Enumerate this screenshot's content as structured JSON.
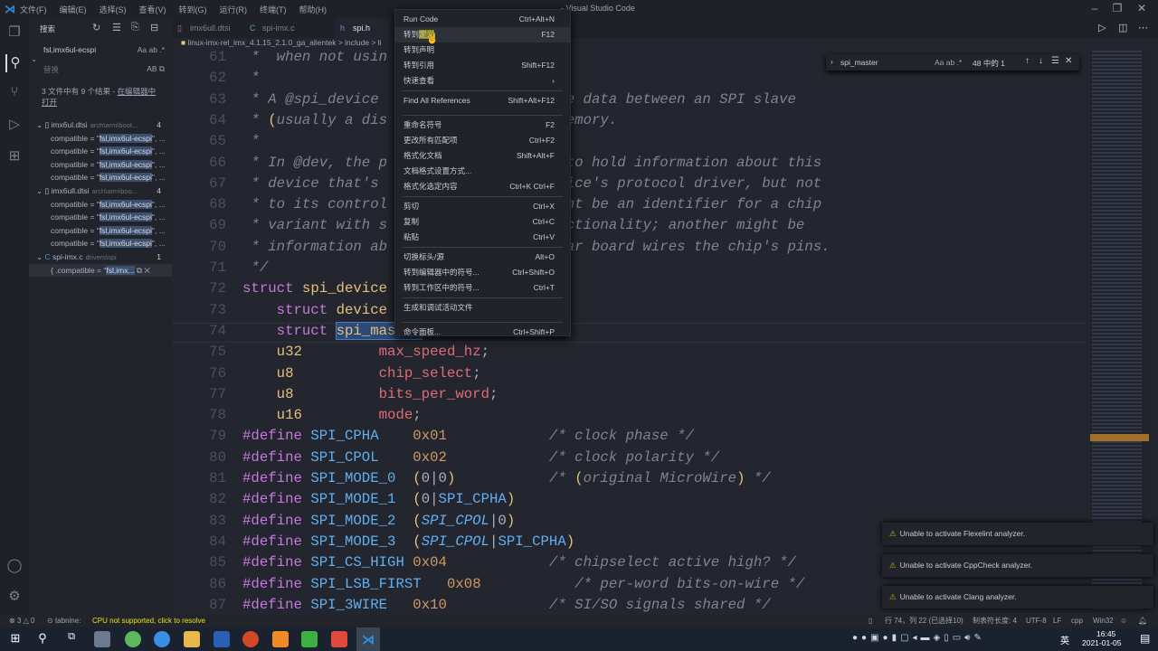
{
  "window": {
    "title": "- Visual Studio Code",
    "menus": [
      "文件(F)",
      "编辑(E)",
      "选择(S)",
      "查看(V)",
      "转到(G)",
      "运行(R)",
      "终端(T)",
      "帮助(H)"
    ]
  },
  "sidebar": {
    "title": "搜索",
    "search_value": "fsl,imx6ul-ecspi",
    "replace_placeholder": "替换",
    "summary": "3 文件中有 9 个结果 - ",
    "open_in_editor": "在编辑器中打开",
    "files": [
      {
        "name": "imx6ul.dtsi",
        "path": "arch\\arm\\boot...",
        "count": "4",
        "matches": [
          "compatible = \"|fsl,imx6ul-ecspi|\", ...",
          "compatible = \"|fsl,imx6ul-ecspi|\", ...",
          "compatible = \"|fsl,imx6ul-ecspi|\", ...",
          "compatible = \"|fsl,imx6ul-ecspi|\", ..."
        ]
      },
      {
        "name": "imx6ull.dtsi",
        "path": "arch\\arm\\boo...",
        "count": "4",
        "matches": [
          "compatible = \"|fsl,imx6ul-ecspi|\", ...",
          "compatible = \"|fsl,imx6ul-ecspi|\", ...",
          "compatible = \"|fsl,imx6ul-ecspi|\", ...",
          "compatible = \"|fsl,imx6ul-ecspi|\", ..."
        ]
      },
      {
        "name": "spi-imx.c",
        "path": "drivers\\spi",
        "count": "1",
        "matches": [
          "{ .compatible = \"|fsl,imx...|"
        ]
      }
    ]
  },
  "tabs": [
    {
      "label": "imx6ull.dtsi",
      "icon": "file-icon"
    },
    {
      "label": "spi-imx.c",
      "icon": "c-file-icon"
    },
    {
      "label": "spi.h",
      "icon": "h-file-icon",
      "active": true
    }
  ],
  "breadcrumb": "linux-imx-rel_imx_4.1.15_2.1.0_ga_alientek > include > li",
  "find": {
    "value": "spi_master",
    "result": "48 中的 1"
  },
  "code": [
    {
      "n": "61",
      "t": [
        [
          "c",
          " *  when not usin"
        ]
      ]
    },
    {
      "n": "62",
      "t": [
        [
          "c",
          " *"
        ]
      ]
    },
    {
      "n": "63",
      "t": [
        [
          "c",
          " * A @spi_device                      e data between an SPI slave"
        ]
      ]
    },
    {
      "n": "64",
      "t": [
        [
          "c",
          " * "
        ],
        [
          "p",
          "("
        ],
        [
          "c",
          "usually a dis                     emory."
        ]
      ]
    },
    {
      "n": "65",
      "t": [
        [
          "c",
          " *"
        ]
      ]
    },
    {
      "n": "66",
      "t": [
        [
          "c",
          " * In @dev, the p                     to hold information about this"
        ]
      ]
    },
    {
      "n": "67",
      "t": [
        [
          "c",
          " * device that's                      ice's protocol driver, but not"
        ]
      ]
    },
    {
      "n": "68",
      "t": [
        [
          "c",
          " * to its control                     ht be an identifier for a chip"
        ]
      ]
    },
    {
      "n": "69",
      "t": [
        [
          "c",
          " * variant with s                     ctionality; another might be"
        ]
      ]
    },
    {
      "n": "70",
      "t": [
        [
          "c",
          " * information ab                     ar board wires the chip's pins."
        ]
      ]
    },
    {
      "n": "71",
      "t": [
        [
          "c",
          " */"
        ]
      ]
    },
    {
      "n": "72",
      "t": [
        [
          "k",
          "struct "
        ],
        [
          "t",
          "spi_device"
        ]
      ]
    },
    {
      "n": "73",
      "t": [
        [
          "x",
          "    "
        ],
        [
          "k",
          "struct "
        ],
        [
          "t",
          "device"
        ]
      ]
    },
    {
      "n": "74",
      "t": [
        [
          "x",
          "    "
        ],
        [
          "k",
          "struct "
        ],
        [
          "ts",
          "spi_master"
        ],
        [
          "x",
          "    "
        ],
        [
          "f",
          "*master"
        ],
        [
          "x",
          ";"
        ]
      ]
    },
    {
      "n": "75",
      "t": [
        [
          "x",
          "    "
        ],
        [
          "t",
          "u32"
        ],
        [
          "x",
          "         "
        ],
        [
          "f",
          "max_speed_hz"
        ],
        [
          "x",
          ";"
        ]
      ]
    },
    {
      "n": "76",
      "t": [
        [
          "x",
          "    "
        ],
        [
          "t",
          "u8"
        ],
        [
          "x",
          "          "
        ],
        [
          "f",
          "chip_select"
        ],
        [
          "x",
          ";"
        ]
      ]
    },
    {
      "n": "77",
      "t": [
        [
          "x",
          "    "
        ],
        [
          "t",
          "u8"
        ],
        [
          "x",
          "          "
        ],
        [
          "f",
          "bits_per_word"
        ],
        [
          "x",
          ";"
        ]
      ]
    },
    {
      "n": "78",
      "t": [
        [
          "x",
          "    "
        ],
        [
          "t",
          "u16"
        ],
        [
          "x",
          "         "
        ],
        [
          "f",
          "mode"
        ],
        [
          "x",
          ";"
        ]
      ]
    },
    {
      "n": "79",
      "t": [
        [
          "k",
          "#define "
        ],
        [
          "m",
          "SPI_CPHA"
        ],
        [
          "x",
          "    "
        ],
        [
          "n",
          "0x01"
        ],
        [
          "x",
          "            "
        ],
        [
          "c",
          "/* clock phase */"
        ]
      ]
    },
    {
      "n": "80",
      "t": [
        [
          "k",
          "#define "
        ],
        [
          "m",
          "SPI_CPOL"
        ],
        [
          "x",
          "    "
        ],
        [
          "n",
          "0x02"
        ],
        [
          "x",
          "            "
        ],
        [
          "c",
          "/* clock polarity */"
        ]
      ]
    },
    {
      "n": "81",
      "t": [
        [
          "k",
          "#define "
        ],
        [
          "m",
          "SPI_MODE_0"
        ],
        [
          "x",
          "  "
        ],
        [
          "p",
          "("
        ],
        [
          "x",
          "0|0"
        ],
        [
          "p",
          ")"
        ],
        [
          "x",
          "           "
        ],
        [
          "c",
          "/* "
        ],
        [
          "p",
          "("
        ],
        [
          "c",
          "original MicroWire"
        ],
        [
          "p",
          ")"
        ],
        [
          "c",
          " */"
        ]
      ]
    },
    {
      "n": "82",
      "t": [
        [
          "k",
          "#define "
        ],
        [
          "m",
          "SPI_MODE_1"
        ],
        [
          "x",
          "  "
        ],
        [
          "p",
          "("
        ],
        [
          "x",
          "0|"
        ],
        [
          "m",
          "SPI_CPHA"
        ],
        [
          "p",
          ")"
        ]
      ]
    },
    {
      "n": "83",
      "t": [
        [
          "k",
          "#define "
        ],
        [
          "m",
          "SPI_MODE_2"
        ],
        [
          "x",
          "  "
        ],
        [
          "p",
          "("
        ],
        [
          "mi",
          "SPI_CPOL"
        ],
        [
          "x",
          "|0"
        ],
        [
          "p",
          ")"
        ]
      ]
    },
    {
      "n": "84",
      "t": [
        [
          "k",
          "#define "
        ],
        [
          "m",
          "SPI_MODE_3"
        ],
        [
          "x",
          "  "
        ],
        [
          "p",
          "("
        ],
        [
          "mi",
          "SPI_CPOL"
        ],
        [
          "x",
          "|"
        ],
        [
          "m",
          "SPI_CPHA"
        ],
        [
          "p",
          ")"
        ]
      ]
    },
    {
      "n": "85",
      "t": [
        [
          "k",
          "#define "
        ],
        [
          "m",
          "SPI_CS_HIGH"
        ],
        [
          "x",
          " "
        ],
        [
          "n",
          "0x04"
        ],
        [
          "x",
          "            "
        ],
        [
          "c",
          "/* chipselect active high? */"
        ]
      ]
    },
    {
      "n": "86",
      "t": [
        [
          "k",
          "#define "
        ],
        [
          "m",
          "SPI_LSB_FIRST"
        ],
        [
          "x",
          "   "
        ],
        [
          "n",
          "0x08"
        ],
        [
          "x",
          "           "
        ],
        [
          "c",
          "/* per-word bits-on-wire */"
        ]
      ]
    },
    {
      "n": "87",
      "t": [
        [
          "k",
          "#define "
        ],
        [
          "m",
          "SPI_3WIRE"
        ],
        [
          "x",
          "   "
        ],
        [
          "n",
          "0x10"
        ],
        [
          "x",
          "            "
        ],
        [
          "c",
          "/* SI/SO signals shared */"
        ]
      ]
    }
  ],
  "context_menu": [
    [
      {
        "label": "Run Code",
        "shortcut": "Ctrl+Alt+N"
      },
      {
        "label": "转到定义",
        "shortcut": "F12",
        "hover": true
      },
      {
        "label": "转到声明",
        "shortcut": ""
      },
      {
        "label": "转到引用",
        "shortcut": "Shift+F12"
      },
      {
        "label": "快速查看",
        "shortcut": "›"
      }
    ],
    [
      {
        "label": "Find All References",
        "shortcut": "Shift+Alt+F12"
      }
    ],
    [
      {
        "label": "重命名符号",
        "shortcut": "F2"
      },
      {
        "label": "更改所有匹配项",
        "shortcut": "Ctrl+F2"
      },
      {
        "label": "格式化文档",
        "shortcut": "Shift+Alt+F"
      },
      {
        "label": "文档格式设置方式...",
        "shortcut": ""
      },
      {
        "label": "格式化选定内容",
        "shortcut": "Ctrl+K Ctrl+F"
      }
    ],
    [
      {
        "label": "剪切",
        "shortcut": "Ctrl+X"
      },
      {
        "label": "复制",
        "shortcut": "Ctrl+C"
      },
      {
        "label": "粘贴",
        "shortcut": "Ctrl+V"
      }
    ],
    [
      {
        "label": "切换标头/源",
        "shortcut": "Alt+O"
      },
      {
        "label": "转到编辑器中的符号...",
        "shortcut": "Ctrl+Shift+O"
      },
      {
        "label": "转到工作区中的符号...",
        "shortcut": "Ctrl+T"
      }
    ],
    [
      {
        "label": "生成和调试活动文件",
        "shortcut": ""
      }
    ],
    [
      {
        "label": "命令面板...",
        "shortcut": "Ctrl+Shift+P"
      }
    ]
  ],
  "notifications": [
    "Unable to activate Flexelint analyzer.",
    "Unable to activate CppCheck analyzer.",
    "Unable to activate Clang analyzer."
  ],
  "status": {
    "errors": "3",
    "warnings": "0",
    "tabnine": "tabnine:",
    "cpu": "CPU not supported, click to resolve",
    "position": "行 74，列 22 (已选择10)",
    "tab_size": "制表符长度: 4",
    "encoding": "UTF-8",
    "eol": "LF",
    "language": "cpp",
    "platform": "Win32"
  },
  "taskbar": {
    "time": "16:45",
    "date": "2021-01-05",
    "ime": "英"
  },
  "colors": {
    "accent": "#007acc",
    "keyword": "#c678dd",
    "type": "#e5c07b",
    "field": "#e06c75",
    "macro": "#61afef",
    "number": "#d19a66",
    "comment": "#7f848e",
    "warning": "#cca700"
  }
}
